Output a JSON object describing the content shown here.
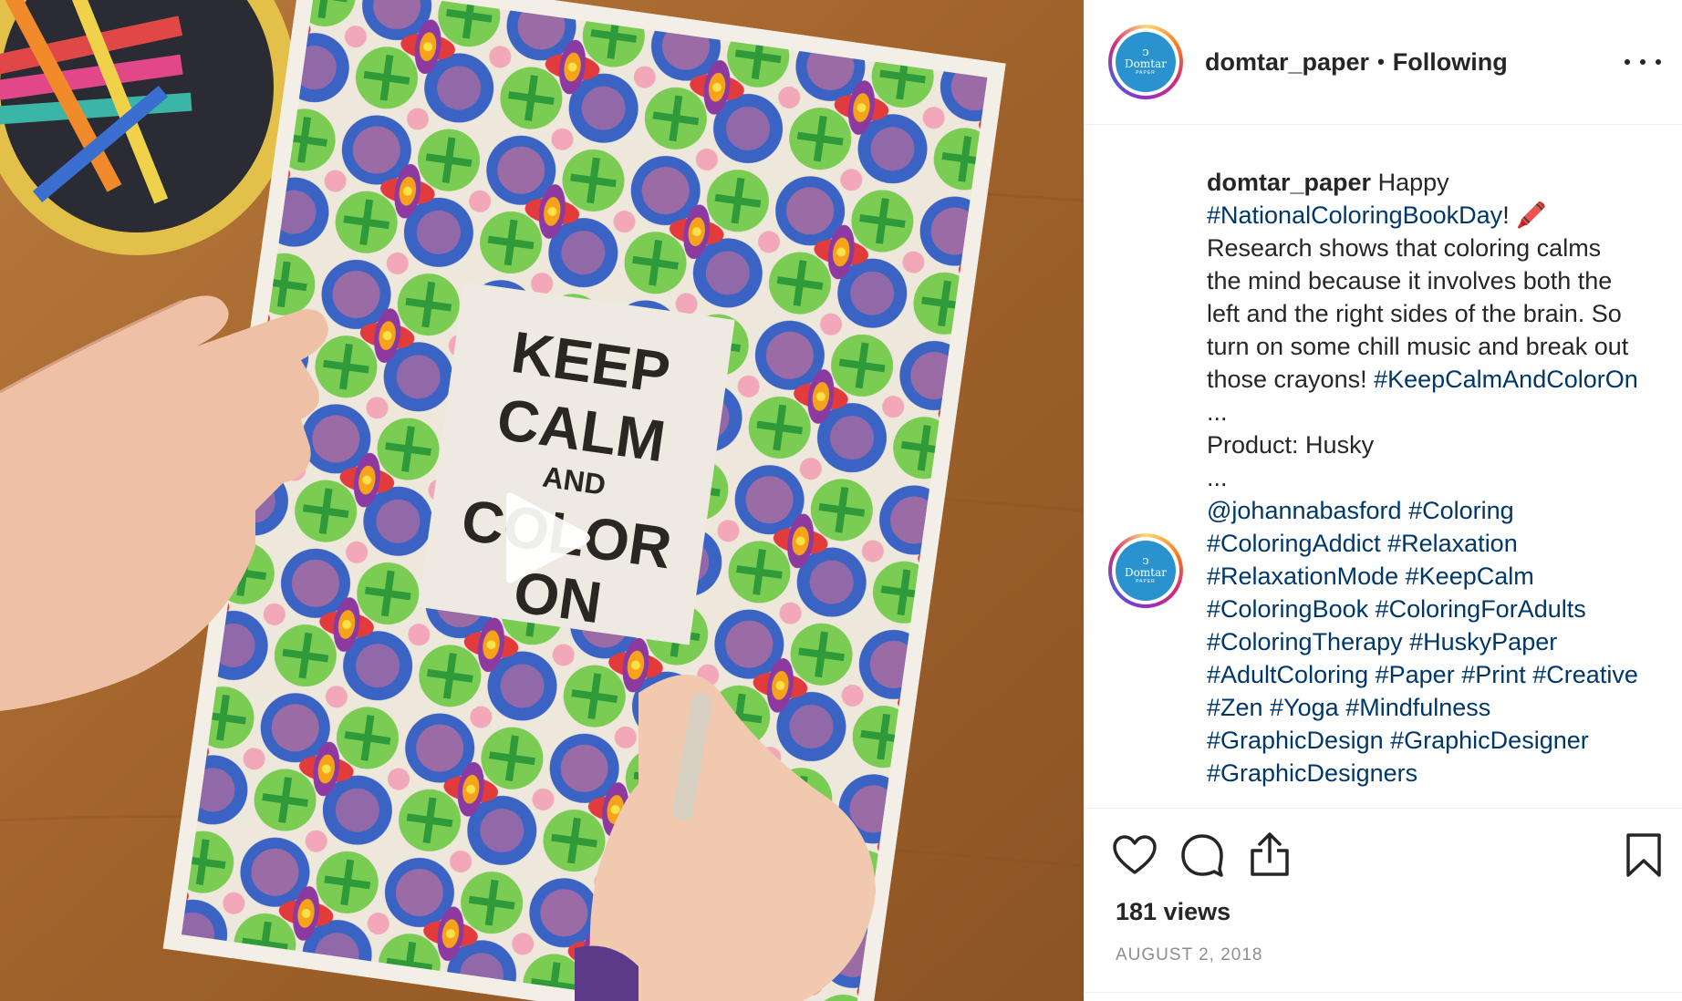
{
  "post": {
    "username": "domtar_paper",
    "separator": "•",
    "follow_status": "Following",
    "avatar": {
      "brand": "Domtar",
      "sub": "PAPER",
      "color": "#2a93cf"
    }
  },
  "media": {
    "type": "video",
    "poster_text": [
      "KEEP",
      "CALM",
      "AND",
      "COLOR",
      "ON"
    ],
    "play_icon": "play-icon"
  },
  "caption": {
    "username": "domtar_paper",
    "lines": [
      [
        {
          "t": "Happy",
          "kind": "text"
        }
      ],
      [
        {
          "t": "#NationalColoringBookDay",
          "kind": "tag"
        },
        {
          "t": "! 🖍️",
          "kind": "text"
        }
      ],
      [
        {
          "t": "Research shows that coloring calms",
          "kind": "text"
        }
      ],
      [
        {
          "t": "the mind because it involves both the",
          "kind": "text"
        }
      ],
      [
        {
          "t": "left and the right sides of the brain. So",
          "kind": "text"
        }
      ],
      [
        {
          "t": "turn on some chill music and break out",
          "kind": "text"
        }
      ],
      [
        {
          "t": "those crayons! ",
          "kind": "text"
        },
        {
          "t": "#KeepCalmAndColorOn",
          "kind": "tag"
        }
      ],
      [
        {
          "t": "...",
          "kind": "text"
        }
      ],
      [
        {
          "t": "Product: Husky",
          "kind": "text"
        }
      ],
      [
        {
          "t": "...",
          "kind": "text"
        }
      ],
      [
        {
          "t": "@johannabasford",
          "kind": "tag"
        },
        {
          "t": " ",
          "kind": "text"
        },
        {
          "t": "#Coloring",
          "kind": "tag"
        }
      ],
      [
        {
          "t": "#ColoringAddict",
          "kind": "tag"
        },
        {
          "t": " ",
          "kind": "text"
        },
        {
          "t": "#Relaxation",
          "kind": "tag"
        }
      ],
      [
        {
          "t": "#RelaxationMode",
          "kind": "tag"
        },
        {
          "t": " ",
          "kind": "text"
        },
        {
          "t": "#KeepCalm",
          "kind": "tag"
        }
      ],
      [
        {
          "t": "#ColoringBook",
          "kind": "tag"
        },
        {
          "t": " ",
          "kind": "text"
        },
        {
          "t": "#ColoringForAdults",
          "kind": "tag"
        }
      ],
      [
        {
          "t": "#ColoringTherapy",
          "kind": "tag"
        },
        {
          "t": " ",
          "kind": "text"
        },
        {
          "t": "#HuskyPaper",
          "kind": "tag"
        }
      ],
      [
        {
          "t": "#AdultColoring",
          "kind": "tag"
        },
        {
          "t": " ",
          "kind": "text"
        },
        {
          "t": "#Paper",
          "kind": "tag"
        },
        {
          "t": " ",
          "kind": "text"
        },
        {
          "t": "#Print",
          "kind": "tag"
        },
        {
          "t": " ",
          "kind": "text"
        },
        {
          "t": "#Creative",
          "kind": "tag"
        }
      ],
      [
        {
          "t": "#Zen",
          "kind": "tag"
        },
        {
          "t": " ",
          "kind": "text"
        },
        {
          "t": "#Yoga",
          "kind": "tag"
        },
        {
          "t": " ",
          "kind": "text"
        },
        {
          "t": "#Mindfulness",
          "kind": "tag"
        }
      ],
      [
        {
          "t": "#GraphicDesign",
          "kind": "tag"
        },
        {
          "t": " ",
          "kind": "text"
        },
        {
          "t": "#GraphicDesigner",
          "kind": "tag"
        }
      ],
      [
        {
          "t": "#GraphicDesigners",
          "kind": "tag"
        }
      ]
    ]
  },
  "actions": {
    "icons": [
      "heart-icon",
      "comment-icon",
      "share-icon",
      "bookmark-icon"
    ],
    "views": "181 views",
    "date": "AUGUST 2, 2018"
  },
  "colors": {
    "link": "#00376b",
    "text": "#262626",
    "muted": "#8e8e8e",
    "border": "#efefef"
  }
}
